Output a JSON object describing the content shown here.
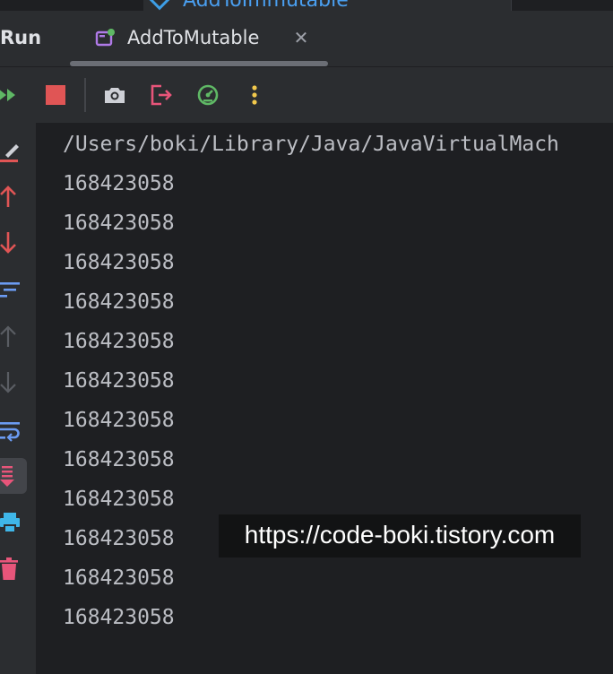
{
  "top_strip": {
    "peek_tab_label": "AddToImmutable"
  },
  "tabbar": {
    "tool_window_label": "Run",
    "tab_label": "AddToMutable",
    "close_glyph": "✕"
  },
  "toolbar": {
    "items": [
      {
        "name": "rerun-icon"
      },
      {
        "name": "stop-icon"
      },
      {
        "name": "camera-icon"
      },
      {
        "name": "exit-icon"
      },
      {
        "name": "profiler-icon"
      },
      {
        "name": "more-vertical-icon"
      }
    ]
  },
  "gutter": {
    "items": [
      {
        "name": "soft-wrap-edit-icon"
      },
      {
        "name": "arrow-up-icon"
      },
      {
        "name": "arrow-down-icon"
      },
      {
        "name": "filter-icon"
      },
      {
        "name": "arrow-up-disabled-icon"
      },
      {
        "name": "arrow-down-disabled-icon"
      },
      {
        "name": "wrap-icon"
      },
      {
        "name": "scroll-to-end-icon"
      },
      {
        "name": "print-icon"
      },
      {
        "name": "trash-icon"
      }
    ]
  },
  "console": {
    "lines": [
      "/Users/boki/Library/Java/JavaVirtualMach",
      "168423058",
      "168423058",
      "168423058",
      "168423058",
      "168423058",
      "168423058",
      "168423058",
      "168423058",
      "168423058",
      "168423058",
      "168423058",
      "168423058"
    ]
  },
  "watermark": {
    "text": "https://code-boki.tistory.com"
  },
  "colors": {
    "background": "#1e1f22",
    "panel": "#2b2d30",
    "text": "#bcbec4",
    "run_green": "#5fb865",
    "stop_red": "#e05555",
    "accent_pink": "#e8557a",
    "accent_blue": "#6b9bf2"
  }
}
